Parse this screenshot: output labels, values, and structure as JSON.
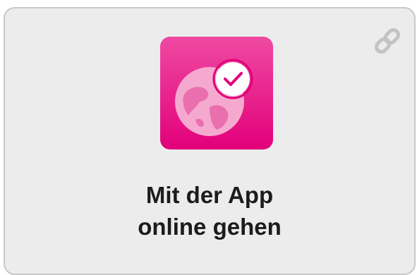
{
  "card": {
    "title_line1": "Mit der App",
    "title_line2": "online gehen",
    "icon": "globe-check-icon",
    "link_icon": "link-icon"
  },
  "colors": {
    "brand_magenta": "#e2007a",
    "card_background": "#ececec",
    "card_border": "#c8c8c8",
    "text": "#1c1c1c"
  }
}
